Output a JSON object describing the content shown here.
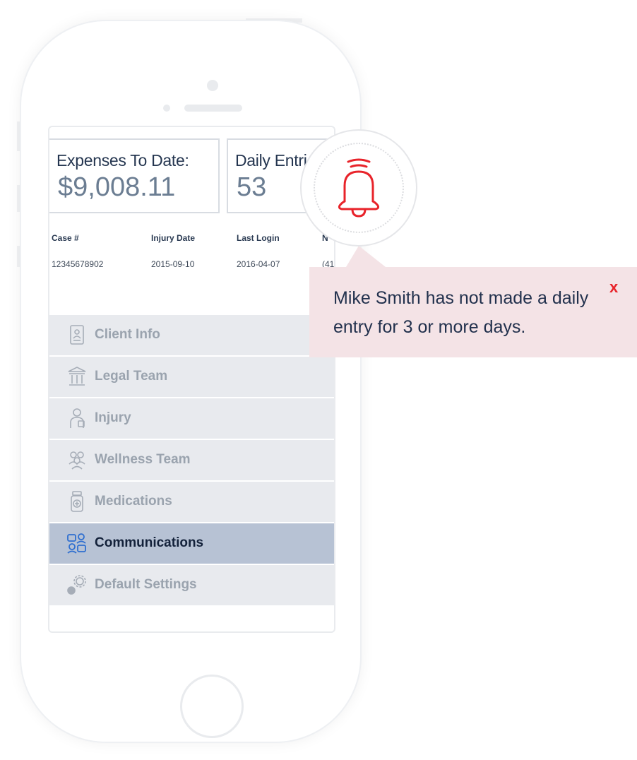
{
  "summary_cards": [
    {
      "label": "Expenses To Date:",
      "value": "$9,008.11"
    },
    {
      "label": "Daily Entri",
      "value": "53"
    }
  ],
  "case_table": {
    "headers": [
      "Case #",
      "Injury Date",
      "Last Login",
      "N"
    ],
    "row": [
      "12345678902",
      "2015-09-10",
      "2016-04-07",
      "(41"
    ]
  },
  "menu": {
    "items": [
      {
        "label": "Client Info",
        "icon": "client-info-icon"
      },
      {
        "label": "Legal Team",
        "icon": "legal-team-icon"
      },
      {
        "label": "Injury",
        "icon": "injury-icon"
      },
      {
        "label": "Wellness Team",
        "icon": "wellness-team-icon"
      },
      {
        "label": "Medications",
        "icon": "medications-icon"
      },
      {
        "label": "Communications",
        "icon": "communications-icon",
        "active": true
      },
      {
        "label": "Default Settings",
        "icon": "settings-gears-icon"
      }
    ]
  },
  "notification": {
    "icon": "bell-icon",
    "message": "Mike Smith has not made a daily entry for 3 or more days.",
    "close_label": "x"
  },
  "colors": {
    "accent_red": "#e8232a",
    "active_menu_bg": "#b7c2d4",
    "popup_bg": "#f4e3e6",
    "heading_navy": "#253650"
  }
}
